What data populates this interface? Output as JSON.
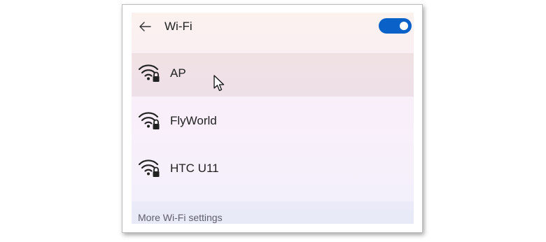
{
  "header": {
    "back_icon": "arrow-left-icon",
    "title": "Wi-Fi",
    "toggle_state": "on",
    "toggle_color": "#0a62c9"
  },
  "networks": [
    {
      "name": "AP",
      "icon": "wifi-secured-icon",
      "hovered": true
    },
    {
      "name": "FlyWorld",
      "icon": "wifi-secured-icon",
      "hovered": false
    },
    {
      "name": "HTC U11",
      "icon": "wifi-secured-icon",
      "hovered": false
    }
  ],
  "footer": {
    "more_settings_label": "More Wi-Fi settings"
  }
}
